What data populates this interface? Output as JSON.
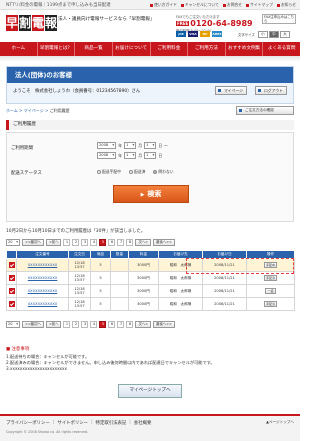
{
  "top_bar": {
    "note": "NTTリ/料金の電報｜1199点まで申し込みも当日配達",
    "links": [
      "使い方ガイド",
      "キャンセルについて",
      "お問合せ",
      "サイトマップ",
      "お知らせ"
    ]
  },
  "header": {
    "logo_chars": [
      "早",
      "割",
      "電",
      "報"
    ],
    "tagline": "法人・議員向け電報サービスなら「早割電報」",
    "phone_label": "FAXでもご注文いただけます",
    "phone_badge": "FREE",
    "phone_number": "0120-64-8989",
    "phone_hours": "受付時間 8:00〜22:00",
    "fax_label": "FAX注申込みはこちら",
    "cards": [
      "JCB",
      "VISA",
      "MC",
      "AMEX"
    ],
    "font_size_label": "文字サイズ",
    "font_sizes": [
      "小",
      "中",
      "大"
    ]
  },
  "nav": [
    "ホーム",
    "早割電報とは？",
    "商品一覧",
    "お届けについて",
    "ご利用料金",
    "ご利用方法",
    "おすすめ文例集",
    "よくある質問"
  ],
  "member": {
    "title": "法人(団体)のお客様",
    "welcome": "ようこそ　株式会社しょうわ（会員番号：01234567890）さん",
    "mypage_button": "マイページ",
    "logout_button": "ログアウト"
  },
  "breadcrumb": {
    "home": "ホーム",
    "mypage": "マイページ",
    "current": "ご利用履歴"
  },
  "howto_button": "ご注文方法の確認",
  "search": {
    "heading": "ご利用履歴",
    "period_label": "ご利用期間",
    "from": {
      "year": "2008",
      "month": "1",
      "day": "1"
    },
    "to": {
      "year": "2008",
      "month": "1",
      "day": "1"
    },
    "unit_year": "年",
    "unit_month": "月",
    "unit_day": "日",
    "range_sep": "〜",
    "status_label": "配送ステータス",
    "statuses": [
      "配送手配中",
      "配送済",
      "問わない"
    ],
    "status_selected": 2,
    "button": "検索"
  },
  "result_summary": "10月2日から10月10日までのご利用履歴は「30件」が該当しました。",
  "pager": {
    "per_page": "20",
    "first": "<<最初へ",
    "prev": "<前へ",
    "next": "次へ>",
    "last": "最後へ>>",
    "pages": [
      "1",
      "2",
      "3",
      "4",
      "5",
      "6",
      "7",
      "8"
    ],
    "current_index": 4
  },
  "table": {
    "headers": [
      "",
      "注文番号",
      "注文日",
      "商品",
      "数量",
      "料金",
      "お届け先",
      "お届け日",
      "操作"
    ],
    "rows": [
      {
        "no": "XXXXXXXXXXXX",
        "date": "12/18\n13:57",
        "product": "5",
        "qty": "",
        "price": "3000円",
        "dest": "昭和　太郎様",
        "delivery": "2008/11/21",
        "action": "手配中"
      },
      {
        "no": "XXXXXXXXXXXX",
        "date": "12/18\n13:57",
        "product": "5",
        "qty": "",
        "price": "3000円",
        "dest": "昭和　太郎様",
        "delivery": "2008/11/21",
        "action": "手配済"
      },
      {
        "no": "XXXXXXXXXXXX",
        "date": "12/18\n13:57",
        "product": "5",
        "qty": "",
        "price": "3000円",
        "dest": "昭和　太郎様",
        "delivery": "2008/11/21",
        "action": "一括"
      },
      {
        "no": "XXXXXXXXXXXX",
        "date": "12/18\n13:57",
        "product": "5",
        "qty": "",
        "price": "3000円",
        "dest": "昭和　太郎様",
        "delivery": "2008/11/21",
        "action": "手配済"
      }
    ]
  },
  "notes": {
    "head": "■ 注意事項",
    "lines": [
      "1.配送待ちの場合：キャンセルが可能です。",
      "2.配送済みの場合：キャンセルができません。申し込み後何時間以内であれば配達日でキャンセルが可能です。",
      "3.xxxxxxxxxxxxxxxxxxxxxxx"
    ]
  },
  "back_button": "マイページトップへ",
  "footer": {
    "links": [
      "プライバシーポリシー",
      "サイトポリシー",
      "特定取引法表記",
      "会社概要"
    ],
    "copyright": "Copyright © 2008 Showa co. All rights reserved.",
    "pagetop": "▲ページトップへ"
  }
}
